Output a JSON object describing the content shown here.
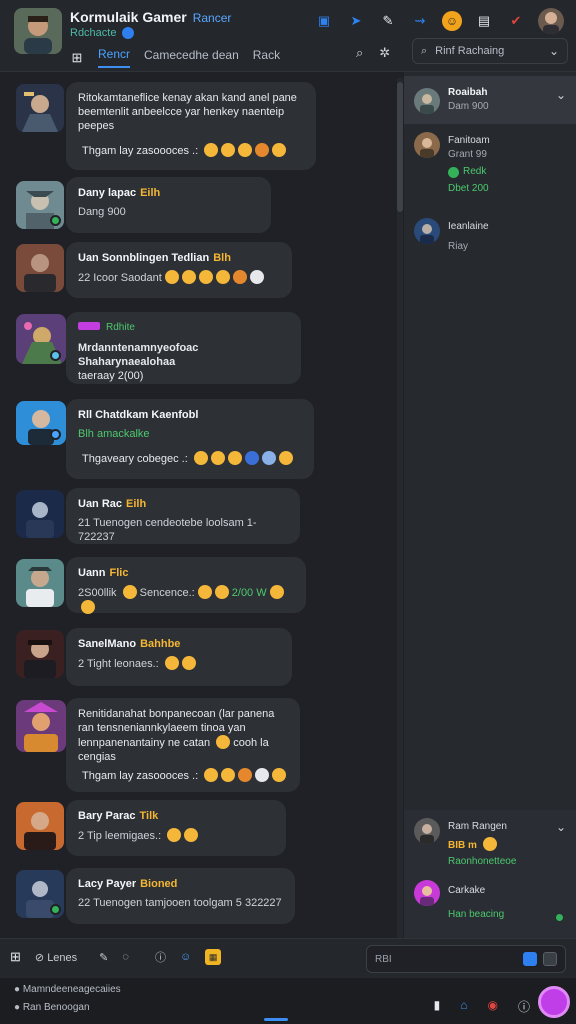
{
  "header": {
    "title": "Kormulaik Gamer",
    "title_accent": "Rancer",
    "subtitle": "Rdchacte",
    "tabs": [
      "Rencr",
      "Camecedhe dean",
      "Rack"
    ],
    "search_placeholder": "Rinf Rachaing"
  },
  "messages": [
    {
      "lines": [
        "Ritokamtaneflice kenay akan kand anel pane",
        "beemtenlit anbeelcce yar henkey naenteip",
        "peepes"
      ],
      "footer": "Thgam lay zasoooces .:"
    },
    {
      "name": "Dany lapac",
      "badge": "Eilh",
      "sub": "Dang 900"
    },
    {
      "name": "Uan Sonnblingen Tedlian",
      "badge": "Blh",
      "sub": "22 Icoor Saodant"
    },
    {
      "tag": "Rdhite",
      "lines": [
        "Mrdanntenamnyeofoac Shaharynaealohaa",
        "taeraay 2(00)"
      ]
    },
    {
      "name": "Rll Chatdkam Kaenfobl",
      "sub": "Blh amackalke",
      "footer": "Thgaveary cobegec .:"
    },
    {
      "name": "Uan Rac",
      "badge": "Eilh",
      "sub": "21 Tuenogen cendeotebe loolsam 1-722237"
    },
    {
      "name": "Uann",
      "badge": "Flic",
      "sub": "2S00llik",
      "sub_tail": "Sencence.:",
      "sub_green": "2/00 W"
    },
    {
      "name": "SanelMano",
      "badge": "Bahhbe",
      "sub": "2 Tight leonaes.:"
    },
    {
      "lines": [
        "Renitidanahat bonpanecoan (lar panena",
        "ran tensneniannkylaeem tinoa yan",
        "lennpanenantainy ne catan",
        "cengias"
      ],
      "line3_tail": "cooh la",
      "footer": "Thgam lay zasoooces .:"
    },
    {
      "name": "Bary Parac",
      "badge": "Tilk",
      "sub": "2 Tip leemigaes.:"
    },
    {
      "name": "Lacy Payer",
      "badge": "Bioned",
      "sub": "22 Tuenogen tamjooen toolgam 5 322227"
    }
  ],
  "right_panel": {
    "items": [
      {
        "name": "Roaibah",
        "sub": "Dam 900"
      },
      {
        "name": "Fanitoam",
        "sub": "Grant 99",
        "status": "Redk",
        "status2": "Dbet 200"
      },
      {
        "name": "Ieanlaine",
        "sub": "Riay"
      }
    ],
    "bottom": [
      {
        "name": "Ram Rangen",
        "sub": "BIB m",
        "status": "Raonhonetteoe"
      },
      {
        "name": "Carkake",
        "sub": "Han beacing"
      }
    ]
  },
  "composer": {
    "items": [
      "Lenes"
    ],
    "input_placeholder": "RBI"
  },
  "footer": {
    "line1": "Mamndeeneagecaiies",
    "line2": "Ran Benoogan"
  }
}
